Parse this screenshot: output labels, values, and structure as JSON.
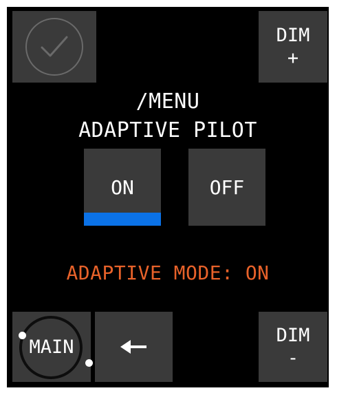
{
  "menu": {
    "path": "/MENU",
    "title": "ADAPTIVE PILOT"
  },
  "top_left": {
    "icon": "checkmark-circle-icon"
  },
  "dim_plus": {
    "label": "DIM",
    "symbol": "+"
  },
  "dim_minus": {
    "label": "DIM",
    "symbol": "-"
  },
  "toggle": {
    "on_label": "ON",
    "off_label": "OFF",
    "selected": "ON"
  },
  "status": {
    "text": "ADAPTIVE MODE: ON"
  },
  "main_button": {
    "label": "MAIN"
  },
  "back_button": {
    "icon": "arrow-left-icon"
  },
  "colors": {
    "background": "#000000",
    "button": "#3a3a3a",
    "text": "#ffffff",
    "accent_active": "#0b72e7",
    "status_text": "#e8622a"
  }
}
